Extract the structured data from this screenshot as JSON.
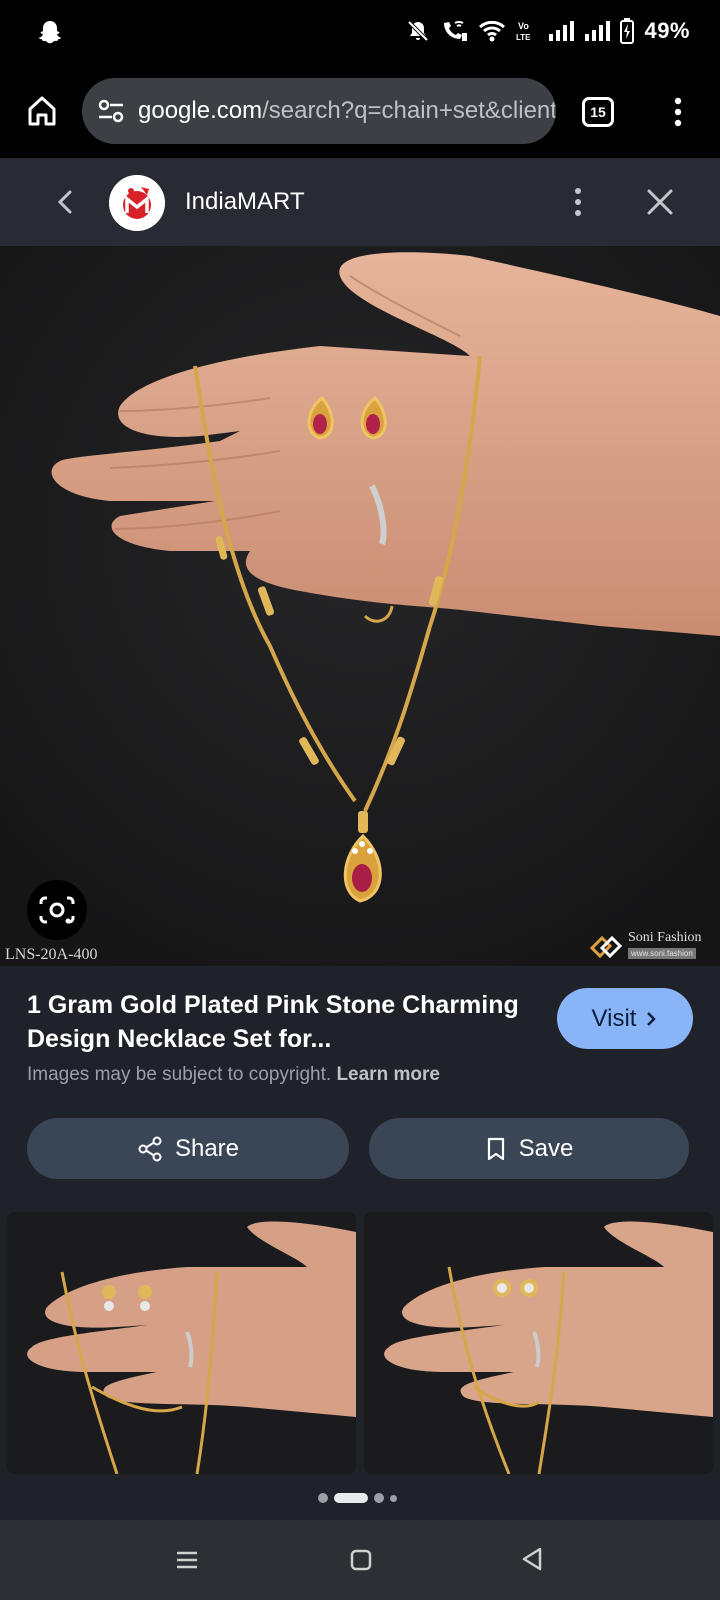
{
  "status_bar": {
    "battery_percent": "49%"
  },
  "browser": {
    "url_domain": "google.com",
    "url_rest": "/search?q=chain+set&client",
    "tab_count": "15"
  },
  "source": {
    "name": "IndiaMART"
  },
  "main_image": {
    "product_code": "LNS-20A-400",
    "watermark_brand": "Soni Fashion",
    "watermark_url": "www.soni.fashion"
  },
  "result": {
    "title": "1 Gram Gold Plated Pink Stone Charming Design Necklace Set for...",
    "visit_label": "Visit",
    "copyright_text": "Images may be subject to copyright.",
    "learn_more_label": "Learn more",
    "share_label": "Share",
    "save_label": "Save"
  },
  "icons": {
    "status_left": "snapchat-icon",
    "home": "home-icon",
    "site_settings": "tune-icon",
    "lens": "google-lens-icon"
  }
}
